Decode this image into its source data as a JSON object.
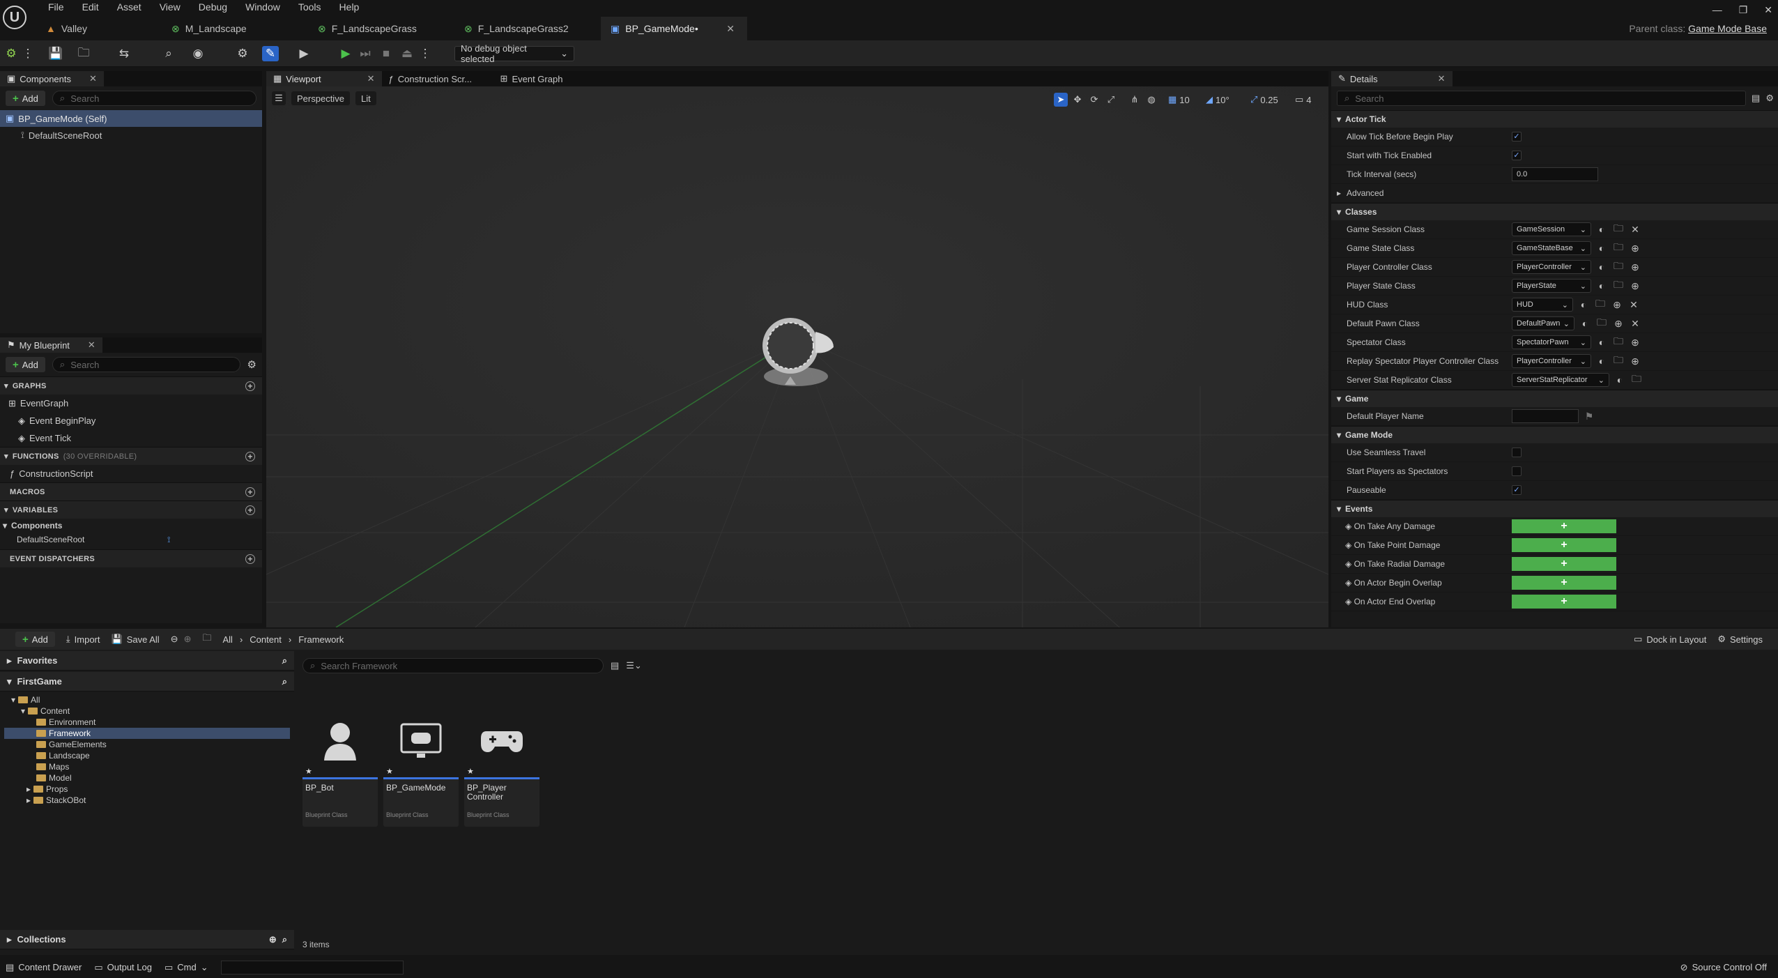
{
  "menu": [
    "File",
    "Edit",
    "Asset",
    "View",
    "Debug",
    "Window",
    "Tools",
    "Help"
  ],
  "tabs": [
    {
      "label": "Valley"
    },
    {
      "label": "M_Landscape"
    },
    {
      "label": "F_LandscapeGrass"
    },
    {
      "label": "F_LandscapeGrass2"
    },
    {
      "label": "BP_GameMode•"
    }
  ],
  "parent_class": {
    "label": "Parent class:",
    "value": "Game Mode Base"
  },
  "toolbar": {
    "debug_object": "No debug object selected"
  },
  "components": {
    "tab": "Components",
    "add": "Add",
    "search_placeholder": "Search",
    "self_item": "BP_GameMode (Self)",
    "root_item": "DefaultSceneRoot"
  },
  "my_blueprint": {
    "tab": "My Blueprint",
    "add": "Add",
    "search_placeholder": "Search",
    "graphs_header": "GRAPHS",
    "event_graph": "EventGraph",
    "event_begin_play": "Event BeginPlay",
    "event_tick": "Event Tick",
    "functions_header": "FUNCTIONS",
    "functions_overridable": "(30 OVERRIDABLE)",
    "construction_script": "ConstructionScript",
    "macros_header": "MACROS",
    "variables_header": "VARIABLES",
    "components_group": "Components",
    "default_scene_root": "DefaultSceneRoot",
    "event_dispatchers_header": "EVENT DISPATCHERS"
  },
  "viewport": {
    "tabs": [
      "Viewport",
      "Construction Scr...",
      "Event Graph"
    ],
    "perspective": "Perspective",
    "lit": "Lit",
    "grid_snap": "10",
    "rotation_snap": "10°",
    "scale_snap": "0.25",
    "camera_speed": "4"
  },
  "details": {
    "tab": "Details",
    "search_placeholder": "Search",
    "actor_tick": {
      "header": "Actor Tick",
      "allow_tick_label": "Allow Tick Before Begin Play",
      "start_with_tick_label": "Start with Tick Enabled",
      "tick_interval_label": "Tick Interval (secs)",
      "tick_interval_value": "0.0",
      "advanced": "Advanced"
    },
    "classes": {
      "header": "Classes",
      "rows": [
        {
          "label": "Game Session Class",
          "value": "GameSession"
        },
        {
          "label": "Game State Class",
          "value": "GameStateBase"
        },
        {
          "label": "Player Controller Class",
          "value": "PlayerController"
        },
        {
          "label": "Player State Class",
          "value": "PlayerState"
        },
        {
          "label": "HUD Class",
          "value": "HUD"
        },
        {
          "label": "Default Pawn Class",
          "value": "DefaultPawn"
        },
        {
          "label": "Spectator Class",
          "value": "SpectatorPawn"
        },
        {
          "label": "Replay Spectator Player Controller Class",
          "value": "PlayerController"
        },
        {
          "label": "Server Stat Replicator Class",
          "value": "ServerStatReplicator"
        }
      ]
    },
    "game": {
      "header": "Game",
      "default_player_name_label": "Default Player Name",
      "default_player_name_value": ""
    },
    "game_mode": {
      "header": "Game Mode",
      "seamless_label": "Use Seamless Travel",
      "spectators_label": "Start Players as Spectators",
      "pauseable_label": "Pauseable"
    },
    "events": {
      "header": "Events",
      "rows": [
        "On Take Any Damage",
        "On Take Point Damage",
        "On Take Radial Damage",
        "On Actor Begin Overlap",
        "On Actor End Overlap"
      ]
    }
  },
  "content_drawer": {
    "add": "Add",
    "import": "Import",
    "save_all": "Save All",
    "breadcrumb": [
      "All",
      "Content",
      "Framework"
    ],
    "dock_in_layout": "Dock in Layout",
    "settings": "Settings",
    "favorites": "Favorites",
    "project": "FirstGame",
    "search_placeholder": "Search Framework",
    "tree": [
      {
        "label": "All",
        "depth": 0
      },
      {
        "label": "Content",
        "depth": 1
      },
      {
        "label": "Environment",
        "depth": 2
      },
      {
        "label": "Framework",
        "depth": 2
      },
      {
        "label": "GameElements",
        "depth": 2
      },
      {
        "label": "Landscape",
        "depth": 2
      },
      {
        "label": "Maps",
        "depth": 2
      },
      {
        "label": "Model",
        "depth": 2
      },
      {
        "label": "Props",
        "depth": 2
      },
      {
        "label": "StackOBot",
        "depth": 2
      }
    ],
    "collections": "Collections",
    "item_count": "3 items",
    "assets": [
      {
        "name": "BP_Bot",
        "type": "Blueprint Class"
      },
      {
        "name": "BP_GameMode",
        "type": "Blueprint Class"
      },
      {
        "name": "BP_Player Controller",
        "type": "Blueprint Class"
      }
    ]
  },
  "status_bar": {
    "content_drawer": "Content Drawer",
    "output_log": "Output Log",
    "cmd": "Cmd",
    "source_control": "Source Control Off"
  },
  "colors": {
    "accent_blue": "#2a64c6",
    "selection": "#3c4d6b",
    "event_add_green": "#4cae4c",
    "folder": "#c9a050"
  }
}
